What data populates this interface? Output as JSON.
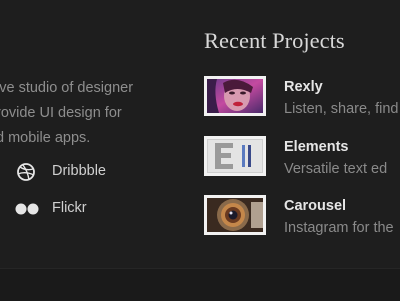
{
  "about": {
    "lines": [
      "ive studio of designer",
      "rovide UI design for",
      "d mobile apps."
    ]
  },
  "social": [
    {
      "label": "Dribbble",
      "icon": "dribbble-icon"
    },
    {
      "label": "Flickr",
      "icon": "flickr-icon"
    }
  ],
  "projects_section": {
    "heading": "Recent Projects",
    "items": [
      {
        "title": "Rexly",
        "description": "Listen, share, find",
        "thumbnail": "portrait-thumbnail"
      },
      {
        "title": "Elements",
        "description": "Versatile text ed",
        "thumbnail": "letter-e-thumbnail"
      },
      {
        "title": "Carousel",
        "description": "Instagram for the",
        "thumbnail": "camera-lens-thumbnail"
      }
    ]
  },
  "colors": {
    "background": "#1e1e1e",
    "heading": "#d8d8d8",
    "muted_text": "#8a8a8a",
    "thumb_border": "#f2f2f2"
  }
}
